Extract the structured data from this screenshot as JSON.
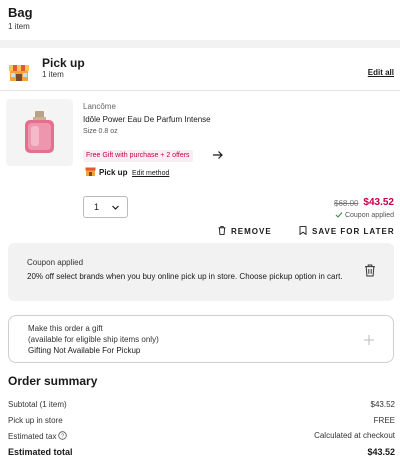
{
  "bag": {
    "title": "Bag",
    "count": "1 item"
  },
  "pickup": {
    "title": "Pick up",
    "count": "1 item",
    "edit_all": "Edit all",
    "icon": "store-icon"
  },
  "product": {
    "brand": "Lancôme",
    "name": "Idôle Power Eau De Parfum Intense",
    "size": "Size 0.8 oz",
    "offer": "Free Gift with purchase + 2 offers",
    "fulfillment_label": "Pick up",
    "edit_method": "Edit method",
    "quantity": "1",
    "price_original": "$68.00",
    "price_sale": "$43.52",
    "coupon_status": "Coupon applied",
    "remove_label": "REMOVE",
    "save_label": "SAVE FOR LATER"
  },
  "coupon": {
    "title": "Coupon applied",
    "description": "20% off select brands when you buy online pick up in store. Choose pickup option in cart."
  },
  "gift": {
    "line1": "Make this order a gift",
    "line2": "(available for eligible ship items only)",
    "line3": "Gifting Not Available For Pickup"
  },
  "summary": {
    "title": "Order summary",
    "rows": [
      {
        "label": "Subtotal (1 item)",
        "value": "$43.52"
      },
      {
        "label": "Pick up in store",
        "value": "FREE"
      },
      {
        "label": "Estimated tax",
        "value": "Calculated at checkout"
      },
      {
        "label": "Estimated total",
        "value": "$43.52"
      }
    ]
  },
  "colors": {
    "accent": "#c3004c",
    "offer_bg": "#fbeef3",
    "panel_bg": "#f2f2f2"
  }
}
